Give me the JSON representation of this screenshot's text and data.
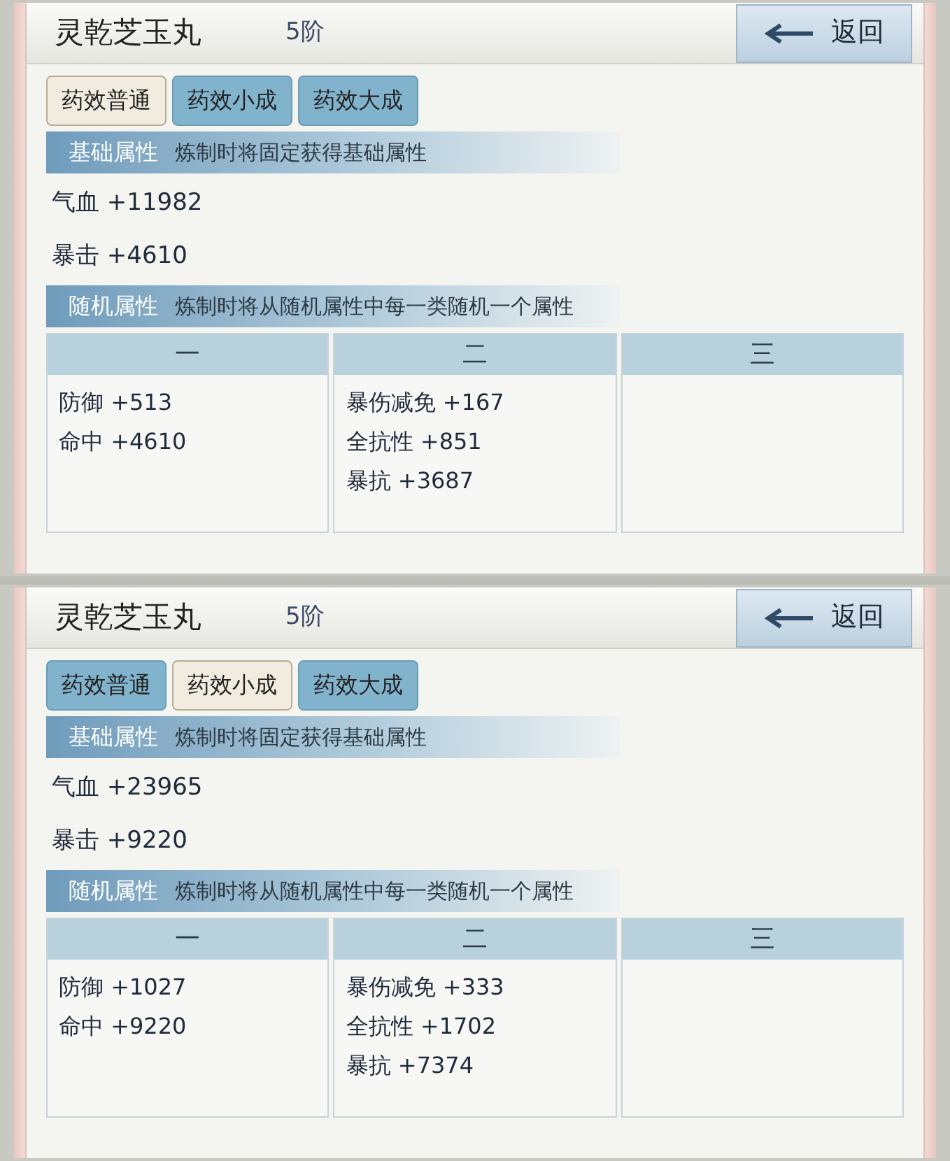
{
  "panels": [
    {
      "title": "灵乾芝玉丸",
      "tier": "5阶",
      "back_button": {
        "label": "返回"
      },
      "tabs": [
        {
          "label": "药效普通",
          "selected": true
        },
        {
          "label": "药效小成",
          "selected": false
        },
        {
          "label": "药效大成",
          "selected": false
        }
      ],
      "base_section": {
        "label": "基础属性",
        "description": "炼制时将固定获得基础属性"
      },
      "base_stats": [
        "气血 +11982",
        "暴击 +4610"
      ],
      "random_section": {
        "label": "随机属性",
        "description": "炼制时将从随机属性中每一类随机一个属性"
      },
      "columns": [
        {
          "header": "一",
          "stats": [
            "防御 +513",
            "命中 +4610"
          ]
        },
        {
          "header": "二",
          "stats": [
            "暴伤减免 +167",
            "全抗性 +851",
            "暴抗 +3687"
          ]
        },
        {
          "header": "三"
        }
      ]
    },
    {
      "title": "灵乾芝玉丸",
      "tier": "5阶",
      "back_button": {
        "label": "返回"
      },
      "tabs": [
        {
          "label": "药效普通",
          "selected": false
        },
        {
          "label": "药效小成",
          "selected": true
        },
        {
          "label": "药效大成",
          "selected": false
        }
      ],
      "base_section": {
        "label": "基础属性",
        "description": "炼制时将固定获得基础属性"
      },
      "base_stats": [
        "气血 +23965",
        "暴击 +9220"
      ],
      "random_section": {
        "label": "随机属性",
        "description": "炼制时将从随机属性中每一类随机一个属性"
      },
      "columns": [
        {
          "header": "一",
          "stats": [
            "防御 +1027",
            "命中 +9220"
          ]
        },
        {
          "header": "二",
          "stats": [
            "暴伤减免 +333",
            "全抗性 +1702",
            "暴抗 +7374"
          ]
        },
        {
          "header": "三"
        }
      ]
    }
  ]
}
